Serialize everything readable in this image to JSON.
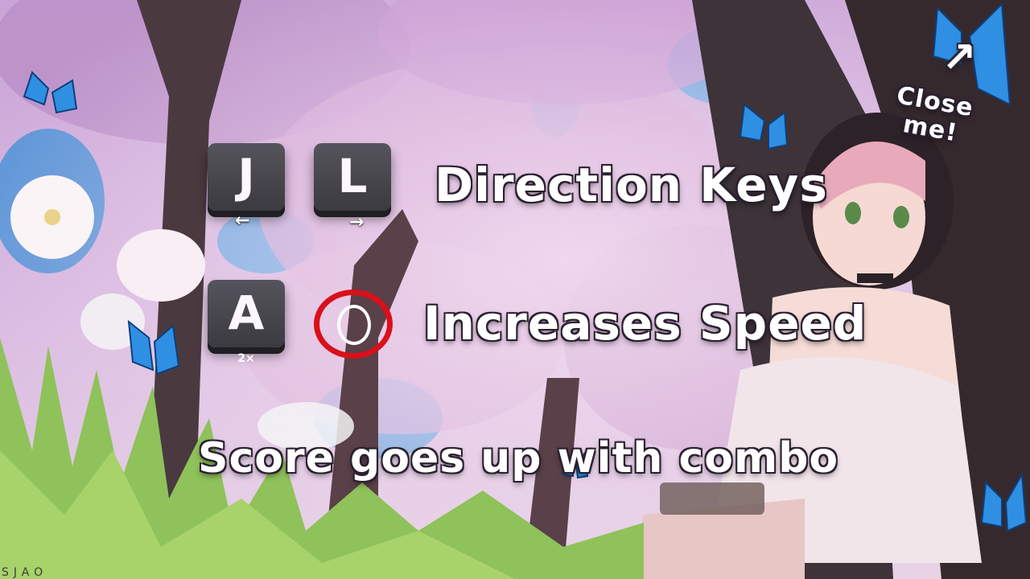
{
  "keys": {
    "j_label": "J",
    "l_label": "L",
    "a_label": "A",
    "a_sub": "2×",
    "j_arrow": "←",
    "l_arrow": "→"
  },
  "lines": {
    "direction": "Direction Keys",
    "speed": "Increases Speed",
    "score": "Score goes up with combo"
  },
  "close": {
    "line1": "Close",
    "line2": "me!",
    "arrow": "↗"
  },
  "watermark": "SJAO",
  "colors": {
    "ring": "#d9101a",
    "key_face": "#4a4950",
    "text": "#ffffff"
  }
}
